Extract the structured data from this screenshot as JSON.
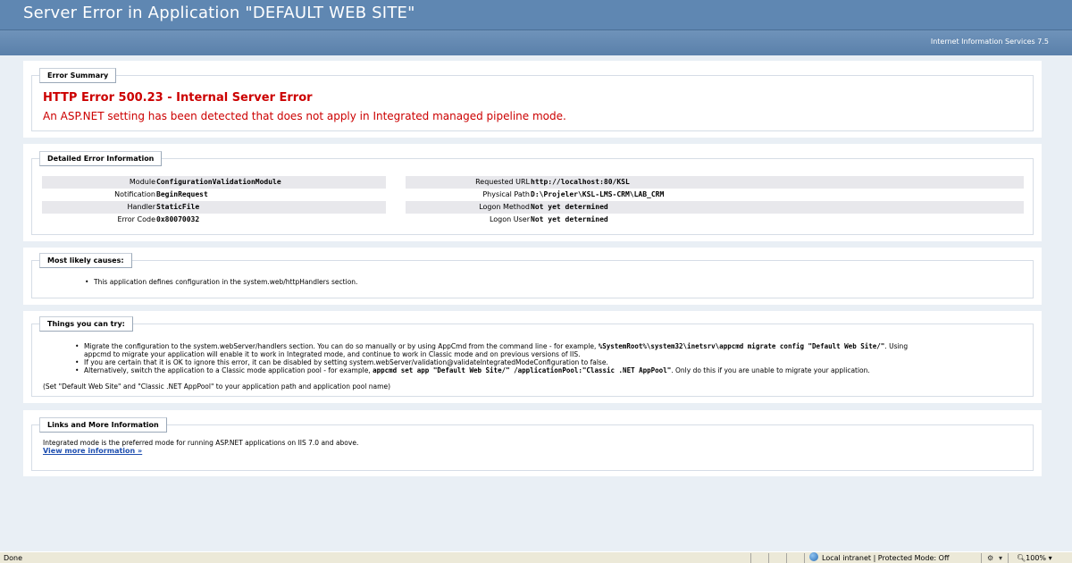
{
  "header": {
    "title": "Server Error in Application \"DEFAULT WEB SITE\"",
    "product": "Internet Information Services 7.5"
  },
  "summary": {
    "legend": "Error Summary",
    "title": "HTTP Error 500.23 - Internal Server Error",
    "description": "An ASP.NET setting has been detected that does not apply in Integrated managed pipeline mode."
  },
  "detailed": {
    "legend": "Detailed Error Information",
    "left": [
      {
        "label": "Module",
        "value": "ConfigurationValidationModule"
      },
      {
        "label": "Notification",
        "value": "BeginRequest"
      },
      {
        "label": "Handler",
        "value": "StaticFile"
      },
      {
        "label": "Error Code",
        "value": "0x80070032"
      }
    ],
    "right": [
      {
        "label": "Requested URL",
        "value": "http://localhost:80/KSL"
      },
      {
        "label": "Physical Path",
        "value": "D:\\Projeler\\KSL-LMS-CRM\\LAB_CRM"
      },
      {
        "label": "Logon Method",
        "value": "Not yet determined"
      },
      {
        "label": "Logon User",
        "value": "Not yet determined"
      }
    ]
  },
  "causes": {
    "legend": "Most likely causes:",
    "items": [
      "This application defines configuration in the system.web/httpHandlers section."
    ]
  },
  "try": {
    "legend": "Things you can try:",
    "item1_a": "Migrate the configuration to the system.webServer/handlers section. You can do so manually or by using AppCmd from the command line - for example, ",
    "item1_code": "%SystemRoot%\\system32\\inetsrv\\appcmd migrate config \"Default Web Site/\"",
    "item1_b": ". Using",
    "item1_c": "appcmd to migrate your application will enable it to work in Integrated mode, and continue to work in Classic mode and on previous versions of IIS.",
    "item2": "If you are certain that it is OK to ignore this error, it can be disabled by setting system.webServer/validation@validateIntegratedModeConfiguration to false.",
    "item3_a": "Alternatively, switch the application to a Classic mode application pool - for example, ",
    "item3_code": "appcmd set app \"Default Web Site/\" /applicationPool:\"Classic .NET AppPool\"",
    "item3_b": ". Only do this if you are unable to migrate your application.",
    "note": "(Set \"Default Web Site\" and \"Classic .NET AppPool\" to your application path and application pool name)"
  },
  "links": {
    "legend": "Links and More Information",
    "text": "Integrated mode is the preferred mode for running ASP.NET applications on IIS 7.0 and above.",
    "more": "View more information »"
  },
  "statusbar": {
    "status": "Done",
    "zone": "Local intranet | Protected Mode: Off",
    "zoom": "100%",
    "zone_icon": "globe-icon"
  }
}
